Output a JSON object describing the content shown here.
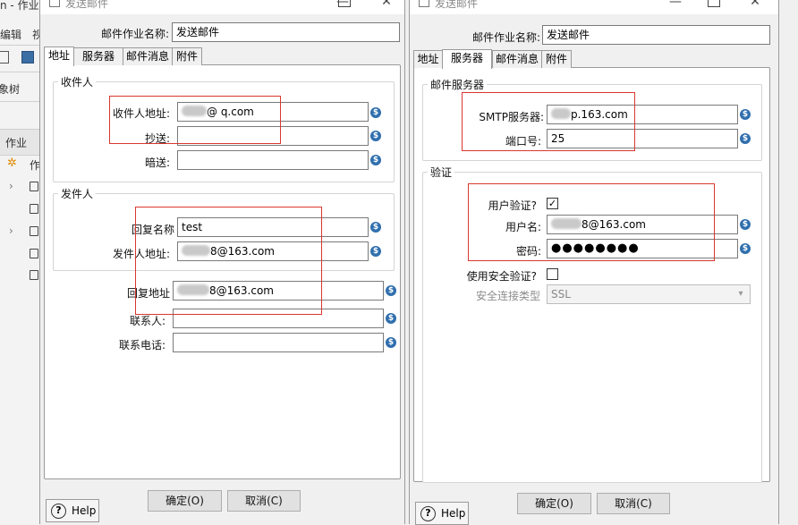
{
  "background_app": {
    "title_fragment": "n - 作业",
    "menu": [
      "编辑",
      "视"
    ],
    "tree_tab": "象树",
    "selected_node": "作业",
    "node_label": "作"
  },
  "dialog_left": {
    "window_title": "发送邮件",
    "job_name_label": "邮件作业名称:",
    "job_name_value": "发送邮件",
    "tabs": [
      "地址",
      "服务器",
      "邮件消息",
      "附件"
    ],
    "active_tab": 0,
    "recipient_group": {
      "title": "收件人",
      "to_label": "收件人地址:",
      "to_value": "@ q.com",
      "cc_label": "抄送:",
      "cc_value": "",
      "bcc_label": "暗送:",
      "bcc_value": ""
    },
    "sender_group": {
      "title": "发件人",
      "reply_name_label": "回复名称",
      "reply_name_value": "test",
      "sender_addr_label": "发件人地址:",
      "sender_addr_value": "8@163.com"
    },
    "reply_addr_label": "回复地址",
    "reply_addr_value": "8@163.com",
    "contact_label": "联系人:",
    "contact_value": "",
    "phone_label": "联系电话:",
    "phone_value": "",
    "ok_label": "确定(O)",
    "cancel_label": "取消(C)",
    "help_label": "Help"
  },
  "dialog_right": {
    "window_title": "发送邮件",
    "job_name_label": "邮件作业名称:",
    "job_name_value": "发送邮件",
    "tabs": [
      "地址",
      "服务器",
      "邮件消息",
      "附件"
    ],
    "active_tab": 1,
    "server_group": {
      "title": "邮件服务器",
      "smtp_label": "SMTP服务器:",
      "smtp_value": "p.163.com",
      "port_label": "端口号:",
      "port_value": "25"
    },
    "auth_group": {
      "title": "验证",
      "auth_label": "用户验证?",
      "auth_checked": true,
      "user_label": "用户名:",
      "user_value": "8@163.com",
      "password_label": "密码:",
      "password_mask": "●●●●●●●●",
      "secure_label": "使用安全验证?",
      "secure_checked": false,
      "conn_type_label": "安全连接类型",
      "conn_type_value": "SSL"
    },
    "ok_label": "确定(O)",
    "cancel_label": "取消(C)",
    "help_label": "Help"
  },
  "colors": {
    "highlight": "#d9372f",
    "variable_icon": "#2f6fae"
  },
  "icons": [
    "window-icon",
    "minimize-icon",
    "maximize-icon",
    "close-icon",
    "variable-icon",
    "help-icon",
    "checkbox-check-icon",
    "folder-icon",
    "chevron-right-icon",
    "dropdown-arrow-icon"
  ]
}
